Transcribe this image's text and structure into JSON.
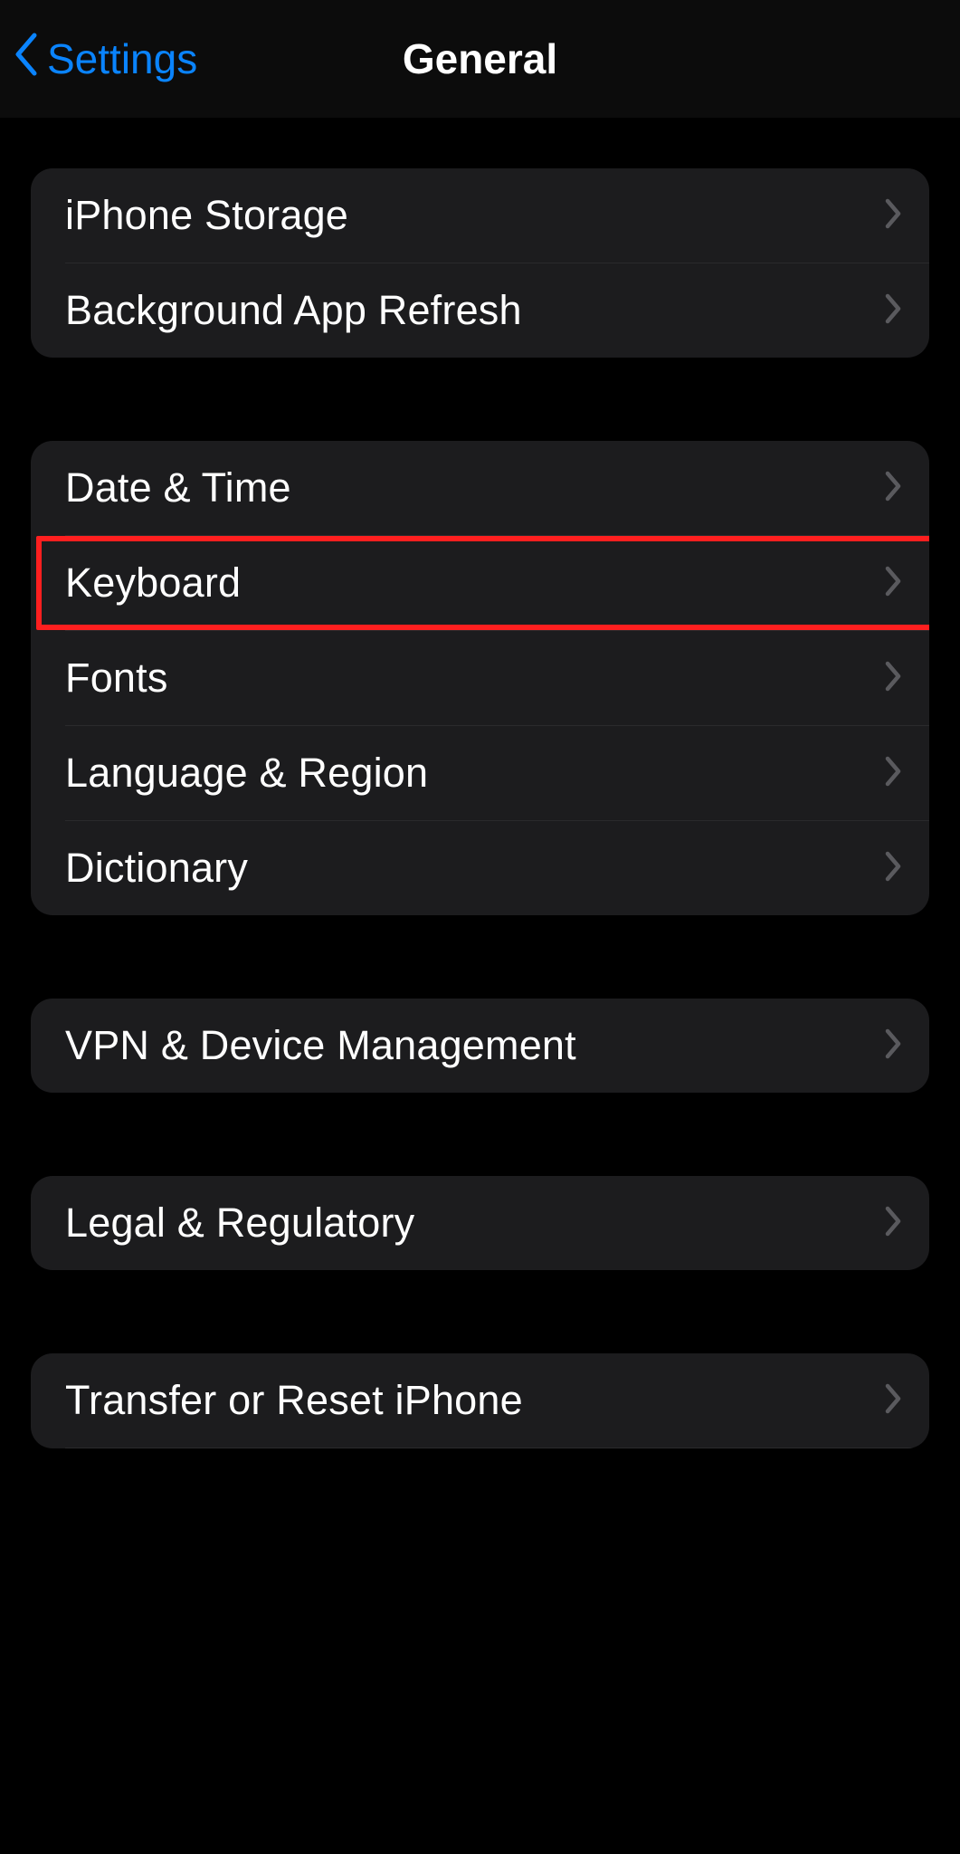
{
  "nav": {
    "back_label": "Settings",
    "title": "General"
  },
  "groups": [
    {
      "rows": [
        {
          "id": "iphone-storage",
          "label": "iPhone Storage"
        },
        {
          "id": "background-app-refresh",
          "label": "Background App Refresh"
        }
      ]
    },
    {
      "rows": [
        {
          "id": "date-time",
          "label": "Date & Time"
        },
        {
          "id": "keyboard",
          "label": "Keyboard",
          "highlighted": true
        },
        {
          "id": "fonts",
          "label": "Fonts"
        },
        {
          "id": "language-region",
          "label": "Language & Region"
        },
        {
          "id": "dictionary",
          "label": "Dictionary"
        }
      ]
    },
    {
      "rows": [
        {
          "id": "vpn-device-management",
          "label": "VPN & Device Management"
        }
      ]
    },
    {
      "rows": [
        {
          "id": "legal-regulatory",
          "label": "Legal & Regulatory"
        }
      ]
    },
    {
      "rows": [
        {
          "id": "transfer-reset",
          "label": "Transfer or Reset iPhone"
        }
      ]
    }
  ],
  "highlight": {
    "color": "#ff1f1f"
  }
}
